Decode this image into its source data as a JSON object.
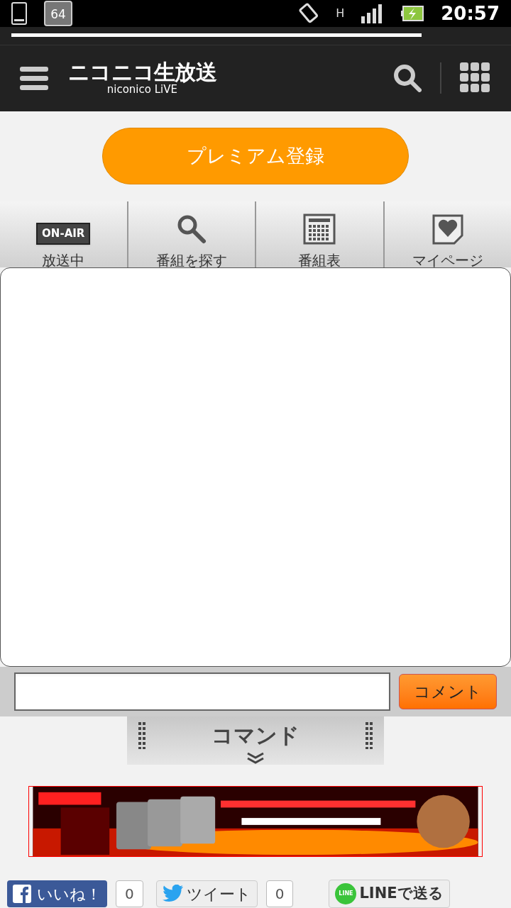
{
  "status_bar": {
    "badge": "64",
    "network": "H",
    "time": "20:57"
  },
  "header": {
    "logo_title": "ニコニコ生放送",
    "logo_subtitle": "niconico LiVE"
  },
  "premium_button": "プレミアム登録",
  "nav_tabs": [
    {
      "kind": "onair",
      "icon_text": "ON-AIR",
      "label": "放送中"
    },
    {
      "kind": "search",
      "label": "番組を探す"
    },
    {
      "kind": "schedule",
      "label": "番組表"
    },
    {
      "kind": "mypage",
      "label": "マイページ"
    }
  ],
  "comment": {
    "button": "コメント"
  },
  "command": {
    "label": "コマンド"
  },
  "social": [
    {
      "kind": "facebook",
      "label": "いいね！",
      "count": "0"
    },
    {
      "kind": "twitter",
      "label": "ツイート",
      "count": "0"
    },
    {
      "kind": "line",
      "label": "LINEで送る",
      "icon_text": "LINE"
    }
  ]
}
